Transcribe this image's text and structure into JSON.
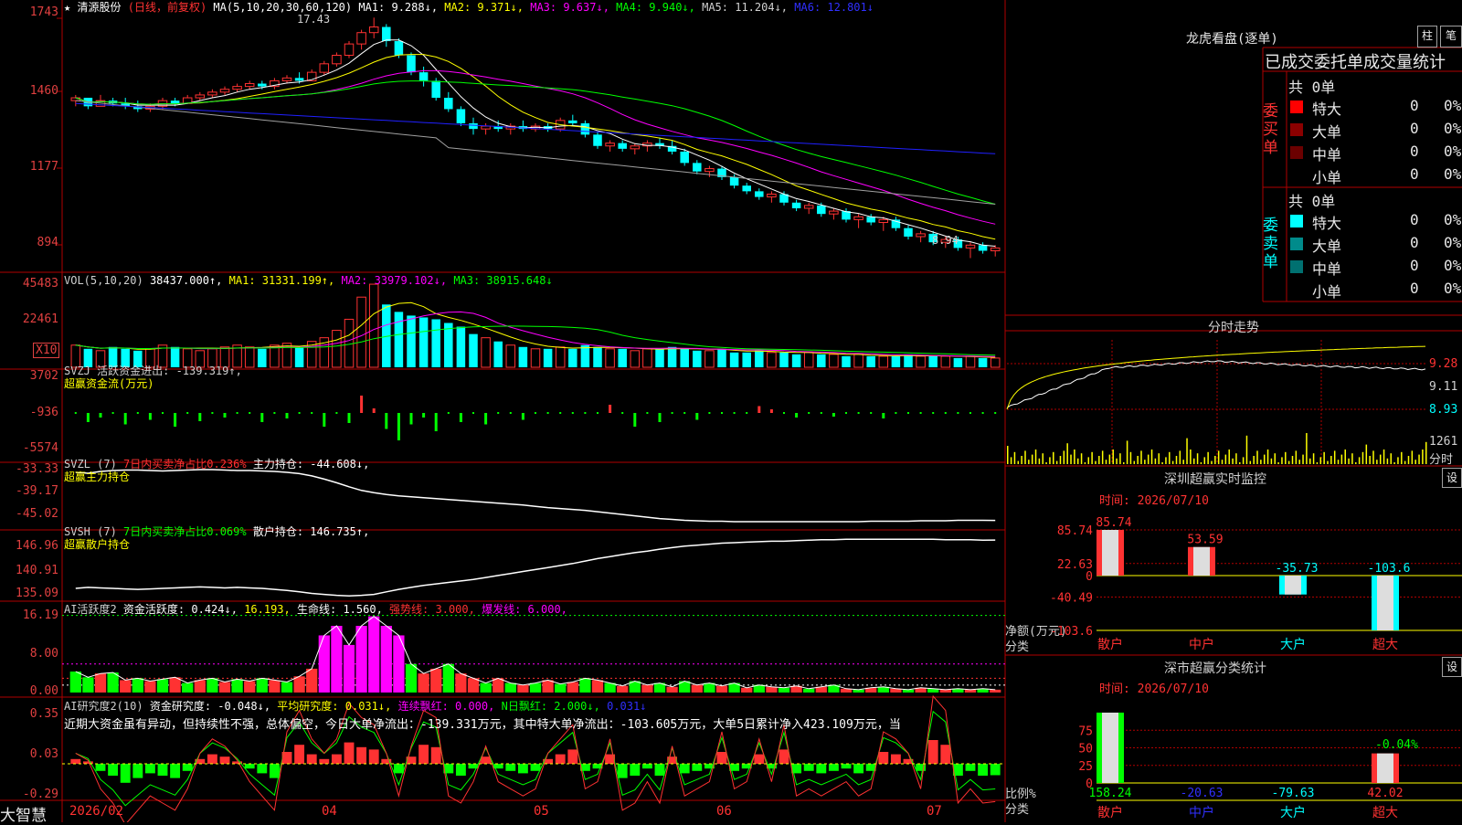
{
  "main_header": {
    "star": "★",
    "stock_name": "清源股份",
    "period": "(日线，前复权)",
    "ma_params": "MA(5,10,20,30,60,120)",
    "ma1": "MA1: 9.288↓,",
    "ma2": "MA2: 9.371↓,",
    "ma3": "MA3: 9.637↓,",
    "ma4": "MA4: 9.940↓,",
    "ma5": "MA5: 11.204↓,",
    "ma6": "MA6: 12.801↓",
    "high_mark": "17.43",
    "low_mark": "8.94"
  },
  "main_axis": [
    "1743",
    "1460",
    "1177",
    "894"
  ],
  "vol_header": {
    "params": "VOL(5,10,20)",
    "value": "38437.000↑,",
    "ma1": "MA1: 31331.199↑,",
    "ma2": "MA2: 33979.102↓,",
    "ma3": "MA3: 38915.648↓"
  },
  "vol_axis": [
    "45483",
    "22461",
    "X10"
  ],
  "svzj": {
    "title": "SVZJ  活跃资金进出: -139.319↑,",
    "subtitle": "超赢资金流(万元)",
    "axis": [
      "3702",
      "-936",
      "-5574"
    ]
  },
  "svzl": {
    "title_a": "SVZL (7)",
    "title_b": "7日内买卖净占比0.236%",
    "title_c": "主力持仓: -44.608↓,",
    "subtitle": "超赢主力持仓",
    "axis": [
      "-33.33",
      "-39.17",
      "-45.02"
    ]
  },
  "svsh": {
    "title_a": "SVSH (7)",
    "title_b": "7日内买卖净占比0.069%",
    "title_c": "散户持仓: 146.735↑,",
    "subtitle": "超赢散户持仓",
    "axis": [
      "146.96",
      "140.91",
      "135.09"
    ]
  },
  "ai_active": {
    "title_a": "AI活跃度2",
    "title_b": "资金活跃度: 0.424↓,",
    "title_c": "16.193,",
    "title_d": "生命线: 1.560,",
    "title_e": "强势线: 3.000,",
    "title_f": "爆发线: 6.000,",
    "axis": [
      "16.19",
      "8.00",
      "0.00"
    ]
  },
  "ai_research": {
    "title_a": "AI研究度2(10)",
    "title_b": "资金研究度: -0.048↓,",
    "title_c": "平均研究度: 0.031↓,",
    "title_d": "连续飘红: 0.000,",
    "title_e": "N日飘红: 2.000↓,",
    "title_f": "0.031↓",
    "comment": "近期大资金虽有异动，但持续性不强，总体偏空，今日大单净流出：-139.331万元，其中特大单净流出：-103.605万元，大单5日累计净入423.109万元，当",
    "axis": [
      "0.35",
      "0.03",
      "-0.29"
    ]
  },
  "time_axis": {
    "brand": "大智慧",
    "labels": [
      "2026/02",
      "04",
      "05",
      "06",
      "07"
    ]
  },
  "longhu": {
    "title": "龙虎看盘(逐单)",
    "btn_a": "柱",
    "btn_b": "笔",
    "subtitle": "已成交委托单成交量统计",
    "buy_label": "委买单",
    "sell_label": "委卖单",
    "buy_total": "共 0单",
    "sell_total": "共 0单",
    "buy_rows": [
      {
        "name": "特大",
        "color": "#ff0000",
        "count": "0",
        "pct": "0%"
      },
      {
        "name": "大单",
        "color": "#8b0000",
        "count": "0",
        "pct": "0%"
      },
      {
        "name": "中单",
        "color": "#6b0000",
        "count": "0",
        "pct": "0%"
      },
      {
        "name": "小单",
        "color": "#000000",
        "count": "0",
        "pct": "0%"
      }
    ],
    "sell_rows": [
      {
        "name": "特大",
        "color": "#00ffff",
        "count": "0",
        "pct": "0%"
      },
      {
        "name": "大单",
        "color": "#008b8b",
        "count": "0",
        "pct": "0%"
      },
      {
        "name": "中单",
        "color": "#007070",
        "count": "0",
        "pct": "0%"
      },
      {
        "name": "小单",
        "color": "#000000",
        "count": "0",
        "pct": "0%"
      }
    ]
  },
  "intraday": {
    "title": "分时走势",
    "axis": [
      "9.28",
      "9.11",
      "8.93"
    ],
    "vol_label": "1261",
    "vol_unit": "分时"
  },
  "monitor": {
    "title": "深圳超赢实时监控",
    "btn": "设",
    "time": "时间: 2026/07/10",
    "axis": [
      "85.74",
      "22.63",
      "0",
      "-40.49",
      "-103.6"
    ],
    "unit_a": "净额(万元)",
    "unit_b": "分类",
    "bars": [
      {
        "cat": "散户",
        "value": 85.74,
        "label": "85.74"
      },
      {
        "cat": "中户",
        "value": 53.59,
        "label": "53.59"
      },
      {
        "cat": "大户",
        "value": -35.73,
        "label": "-35.73"
      },
      {
        "cat": "超大",
        "value": -103.6,
        "label": "-103.6"
      }
    ]
  },
  "classify": {
    "title": "深市超赢分类统计",
    "btn": "设",
    "time": "时间: 2026/07/10",
    "axis": [
      "75",
      "50",
      "25",
      "0"
    ],
    "unit_a": "比例%",
    "unit_b": "分类",
    "top_label": "-0.04%",
    "bars": [
      {
        "cat": "散户",
        "value": 158.24,
        "label": "158.24"
      },
      {
        "cat": "中户",
        "value": -20.63,
        "label": "-20.63"
      },
      {
        "cat": "大户",
        "value": -79.63,
        "label": "-79.63"
      },
      {
        "cat": "超大",
        "value": 42.02,
        "label": "42.02"
      }
    ]
  },
  "colors": {
    "up": "#ff3232",
    "down": "#00ffff",
    "grid": "#b00000",
    "ma1": "#ffffff",
    "ma2": "#ffff00",
    "ma3": "#ff00ff",
    "ma4": "#00ff00",
    "ma5": "#a0a0a0",
    "ma6": "#2020ff"
  },
  "chart_data": [
    {
      "type": "candlestick",
      "title": "清源股份",
      "y_axis_ticks": [
        1743,
        1460,
        1177,
        894
      ],
      "ohlc": [
        [
          14.5,
          14.7,
          14.3,
          14.6
        ],
        [
          14.6,
          14.6,
          14.2,
          14.3
        ],
        [
          14.3,
          14.7,
          14.3,
          14.5
        ],
        [
          14.5,
          14.6,
          14.3,
          14.4
        ],
        [
          14.4,
          14.6,
          14.2,
          14.3
        ],
        [
          14.3,
          14.5,
          14.1,
          14.2
        ],
        [
          14.2,
          14.4,
          14.1,
          14.3
        ],
        [
          14.3,
          14.6,
          14.2,
          14.5
        ],
        [
          14.5,
          14.6,
          14.3,
          14.4
        ],
        [
          14.4,
          14.7,
          14.4,
          14.6
        ],
        [
          14.6,
          14.8,
          14.5,
          14.7
        ],
        [
          14.7,
          14.9,
          14.6,
          14.8
        ],
        [
          14.8,
          15.0,
          14.7,
          14.9
        ],
        [
          14.9,
          15.1,
          14.8,
          15.0
        ],
        [
          15.0,
          15.2,
          14.9,
          15.1
        ],
        [
          15.1,
          15.2,
          14.9,
          15.0
        ],
        [
          15.0,
          15.3,
          14.9,
          15.2
        ],
        [
          15.2,
          15.4,
          15.1,
          15.3
        ],
        [
          15.3,
          15.5,
          15.1,
          15.2
        ],
        [
          15.2,
          15.6,
          15.2,
          15.5
        ],
        [
          15.5,
          15.9,
          15.4,
          15.8
        ],
        [
          15.8,
          16.2,
          15.7,
          16.1
        ],
        [
          16.1,
          16.6,
          16.0,
          16.5
        ],
        [
          16.5,
          17.0,
          16.3,
          16.9
        ],
        [
          16.9,
          17.43,
          16.7,
          17.1
        ],
        [
          17.1,
          17.2,
          16.4,
          16.6
        ],
        [
          16.6,
          16.7,
          16.0,
          16.1
        ],
        [
          16.1,
          16.2,
          15.4,
          15.5
        ],
        [
          15.5,
          15.7,
          15.0,
          15.2
        ],
        [
          15.2,
          15.3,
          14.5,
          14.6
        ],
        [
          14.6,
          14.8,
          14.1,
          14.2
        ],
        [
          14.2,
          14.3,
          13.6,
          13.7
        ],
        [
          13.7,
          13.9,
          13.3,
          13.5
        ],
        [
          13.5,
          13.7,
          13.3,
          13.6
        ],
        [
          13.6,
          13.8,
          13.4,
          13.5
        ],
        [
          13.5,
          13.7,
          13.3,
          13.6
        ],
        [
          13.6,
          13.8,
          13.4,
          13.5
        ],
        [
          13.5,
          13.7,
          13.4,
          13.6
        ],
        [
          13.6,
          13.7,
          13.4,
          13.5
        ],
        [
          13.5,
          13.9,
          13.4,
          13.8
        ],
        [
          13.8,
          14.0,
          13.6,
          13.7
        ],
        [
          13.7,
          13.8,
          13.2,
          13.3
        ],
        [
          13.3,
          13.4,
          12.8,
          12.9
        ],
        [
          12.9,
          13.1,
          12.7,
          13.0
        ],
        [
          13.0,
          13.1,
          12.7,
          12.8
        ],
        [
          12.8,
          13.0,
          12.6,
          12.9
        ],
        [
          12.9,
          13.1,
          12.7,
          13.0
        ],
        [
          13.0,
          13.2,
          12.8,
          12.9
        ],
        [
          12.9,
          13.1,
          12.6,
          12.7
        ],
        [
          12.7,
          12.8,
          12.2,
          12.3
        ],
        [
          12.3,
          12.4,
          11.9,
          12.0
        ],
        [
          12.0,
          12.2,
          11.8,
          12.1
        ],
        [
          12.1,
          12.2,
          11.7,
          11.8
        ],
        [
          11.8,
          11.9,
          11.4,
          11.5
        ],
        [
          11.5,
          11.6,
          11.2,
          11.3
        ],
        [
          11.3,
          11.4,
          11.0,
          11.1
        ],
        [
          11.1,
          11.3,
          10.9,
          11.2
        ],
        [
          11.2,
          11.3,
          10.8,
          10.9
        ],
        [
          10.9,
          11.0,
          10.6,
          10.7
        ],
        [
          10.7,
          10.9,
          10.5,
          10.8
        ],
        [
          10.8,
          10.9,
          10.4,
          10.5
        ],
        [
          10.5,
          10.7,
          10.3,
          10.6
        ],
        [
          10.6,
          10.7,
          10.2,
          10.3
        ],
        [
          10.3,
          10.5,
          10.0,
          10.4
        ],
        [
          10.4,
          10.5,
          10.1,
          10.2
        ],
        [
          10.2,
          10.4,
          9.9,
          10.3
        ],
        [
          10.3,
          10.4,
          9.9,
          10.0
        ],
        [
          10.0,
          10.1,
          9.6,
          9.7
        ],
        [
          9.7,
          9.9,
          9.5,
          9.8
        ],
        [
          9.8,
          9.9,
          9.4,
          9.5
        ],
        [
          9.5,
          9.7,
          9.3,
          9.6
        ],
        [
          9.6,
          9.7,
          9.2,
          9.3
        ],
        [
          9.3,
          9.5,
          8.94,
          9.4
        ],
        [
          9.4,
          9.5,
          9.1,
          9.2
        ],
        [
          9.2,
          9.4,
          9.0,
          9.3
        ]
      ]
    },
    {
      "type": "bar",
      "title": "VOL(5,10,20)",
      "y_axis_ticks": [
        45483,
        22461
      ],
      "values": [
        12,
        10,
        9,
        11,
        10,
        9,
        10,
        12,
        11,
        10,
        9,
        10,
        11,
        12,
        11,
        10,
        12,
        13,
        11,
        14,
        16,
        20,
        26,
        38,
        45,
        34,
        30,
        28,
        27,
        26,
        24,
        22,
        18,
        16,
        14,
        12,
        11,
        10,
        10,
        11,
        10,
        12,
        11,
        10,
        10,
        9,
        10,
        10,
        11,
        10,
        9,
        9,
        10,
        8,
        8,
        9,
        8,
        8,
        7,
        8,
        7,
        7,
        6,
        7,
        6,
        6,
        6,
        7,
        6,
        6,
        6,
        5,
        6,
        5,
        5
      ]
    },
    {
      "type": "bar",
      "title": "超赢资金流(万元)",
      "y_axis_ticks": [
        3702,
        -936,
        -5574
      ],
      "values": [
        0,
        -20,
        -10,
        0,
        -25,
        0,
        -15,
        0,
        -30,
        0,
        -18,
        0,
        -10,
        0,
        0,
        -20,
        0,
        -12,
        0,
        0,
        -30,
        0,
        -22,
        38,
        10,
        -35,
        -60,
        -25,
        -10,
        -40,
        0,
        -20,
        0,
        -25,
        0,
        0,
        -15,
        0,
        0,
        0,
        0,
        0,
        0,
        18,
        0,
        -30,
        0,
        -20,
        0,
        0,
        -15,
        0,
        0,
        0,
        0,
        15,
        8,
        0,
        -10,
        0,
        0,
        -8,
        0,
        0,
        0,
        -12,
        0,
        0,
        0,
        0,
        0,
        0,
        0,
        0,
        0
      ]
    },
    {
      "type": "line",
      "title": "超赢主力持仓",
      "y_axis_ticks": [
        -33.33,
        -39.17,
        -45.02
      ],
      "values": [
        -34,
        -34.2,
        -33.8,
        -33.6,
        -33.5,
        -33.5,
        -33.6,
        -33.7,
        -33.6,
        -33.5,
        -33.4,
        -33.4,
        -33.5,
        -33.6,
        -33.6,
        -33.7,
        -33.8,
        -34,
        -34.3,
        -34.8,
        -35.5,
        -36.3,
        -37.2,
        -38,
        -38.5,
        -38.9,
        -39.2,
        -39.4,
        -39.6,
        -39.8,
        -40,
        -40.2,
        -40.4,
        -40.6,
        -40.8,
        -41,
        -41.2,
        -41.5,
        -41.8,
        -42,
        -42.2,
        -42.4,
        -42.7,
        -43,
        -43.3,
        -43.6,
        -43.9,
        -44.2,
        -44.4,
        -44.6,
        -44.7,
        -44.8,
        -44.8,
        -44.9,
        -44.9,
        -44.9,
        -44.9,
        -44.9,
        -44.9,
        -44.9,
        -44.9,
        -44.9,
        -44.9,
        -44.9,
        -44.8,
        -44.8,
        -44.8,
        -44.8,
        -44.7,
        -44.7,
        -44.7,
        -44.6,
        -44.6,
        -44.6,
        -44.608
      ]
    },
    {
      "type": "line",
      "title": "超赢散户持仓",
      "y_axis_ticks": [
        146.96,
        140.91,
        135.09
      ],
      "values": [
        137,
        137.2,
        137.1,
        137,
        136.9,
        136.8,
        136.9,
        137,
        137.1,
        137.2,
        137.3,
        137.2,
        137.1,
        137.2,
        137.1,
        137,
        136.8,
        136.6,
        136.3,
        136,
        135.8,
        135.6,
        135.5,
        135.6,
        135.8,
        136.3,
        136.8,
        137.2,
        137.6,
        137.9,
        138.2,
        138.5,
        138.8,
        139.2,
        139.6,
        140,
        140.4,
        140.8,
        141.2,
        141.6,
        142,
        142.5,
        143,
        143.4,
        143.8,
        144.2,
        144.5,
        144.9,
        145.2,
        145.5,
        145.7,
        145.9,
        146.1,
        146.2,
        146.3,
        146.4,
        146.5,
        146.5,
        146.6,
        146.7,
        146.8,
        146.8,
        146.9,
        146.9,
        146.9,
        146.9,
        146.9,
        146.9,
        146.9,
        146.9,
        146.8,
        146.8,
        146.8,
        146.7,
        146.735
      ]
    },
    {
      "type": "bar",
      "title": "AI活跃度2",
      "y_axis_ticks": [
        16.19,
        8.0,
        0.0
      ],
      "values": [
        4.4,
        3.2,
        4.0,
        4.2,
        2.6,
        3.0,
        2.4,
        2.8,
        3.2,
        2.0,
        2.6,
        3.0,
        2.2,
        2.8,
        2.4,
        3.0,
        2.6,
        2.2,
        3.4,
        5.0,
        12,
        14,
        10,
        14,
        16,
        14,
        12,
        6,
        4,
        5,
        6,
        4,
        3,
        2,
        3,
        2,
        1.6,
        2.0,
        2.6,
        1.8,
        2.2,
        3.0,
        2.6,
        2.0,
        1.4,
        2.4,
        1.6,
        2.0,
        1.2,
        2.4,
        1.6,
        2.0,
        1.4,
        2.0,
        1.0,
        1.6,
        1.2,
        1.0,
        1.4,
        0.8,
        1.2,
        1.6,
        0.8,
        0.6,
        1.0,
        1.2,
        0.8,
        0.6,
        1.0,
        0.8,
        0.6,
        0.8,
        0.6,
        0.8,
        0.6
      ]
    },
    {
      "type": "bar",
      "title": "AI研究度2(10)",
      "y_axis_ticks": [
        0.35,
        0.03,
        -0.29
      ],
      "values": [
        0.02,
        0.01,
        -0.03,
        -0.05,
        -0.08,
        -0.06,
        -0.04,
        -0.05,
        -0.06,
        -0.03,
        0.02,
        0.04,
        0.03,
        0.01,
        -0.02,
        -0.04,
        -0.06,
        0.05,
        0.08,
        0.04,
        0.02,
        0.04,
        0.09,
        0.07,
        0.06,
        0.02,
        -0.04,
        0.03,
        0.08,
        0.07,
        -0.04,
        -0.05,
        -0.02,
        0.03,
        -0.02,
        -0.03,
        -0.04,
        -0.03,
        0.02,
        0.04,
        0.06,
        -0.03,
        -0.02,
        0.04,
        -0.06,
        -0.05,
        -0.02,
        -0.05,
        0.03,
        -0.04,
        -0.03,
        -0.02,
        0.05,
        -0.03,
        -0.02,
        0.04,
        -0.02,
        0.06,
        -0.04,
        -0.03,
        -0.04,
        -0.03,
        -0.02,
        -0.04,
        -0.03,
        0.05,
        0.04,
        0.02,
        -0.03,
        0.1,
        0.08,
        -0.05,
        -0.03,
        -0.05,
        -0.048
      ]
    }
  ]
}
